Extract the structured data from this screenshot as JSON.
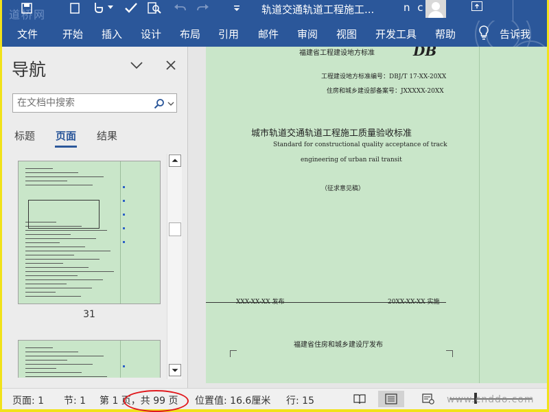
{
  "app": {
    "document_title": "轨道交通轨道工程施工...",
    "user_initials": "n c",
    "watermark_logo": "道桥网"
  },
  "ribbon": {
    "tabs": [
      "文件",
      "开始",
      "插入",
      "设计",
      "布局",
      "引用",
      "邮件",
      "审阅",
      "视图",
      "开发工具",
      "帮助"
    ],
    "tell_me": "告诉我"
  },
  "nav": {
    "title": "导航",
    "search_placeholder": "在文档中搜索",
    "tabs": [
      "标题",
      "页面",
      "结果"
    ],
    "active_tab": "页面",
    "thumbnail_page": "31"
  },
  "document": {
    "header_org": "福建省工程建设地方标准",
    "header_mark": "DB",
    "code1": "工程建设地方标准编号：DBJ/T 17-XX-20XX",
    "code2": "住房和城乡建设部备案号：JXXXXX-20XX",
    "title_cn": "城市轨道交通轨道工程施工质量验收标准",
    "title_en_1": "Standard for constructional quality acceptance of track",
    "title_en_2": "engineering of urban rail transit",
    "draft_note": "（征求意见稿）",
    "issue_date": "XXX-XX-XX  发布",
    "effective_date": "20XX-XX-XX   实施",
    "publisher": "福建省住房和城乡建设厅发布"
  },
  "status": {
    "page": "页面: 1",
    "section": "节: 1",
    "page_of": "第 1 页，共 99 页",
    "position": "位置值: 16.6厘米",
    "line": "行: 15",
    "watermark": "www.cnddo.com"
  },
  "colors": {
    "word_blue": "#2b579a",
    "page_green": "#c9e6c9",
    "highlight_border": "#f1e21a",
    "annotation_red": "#e0191d"
  }
}
